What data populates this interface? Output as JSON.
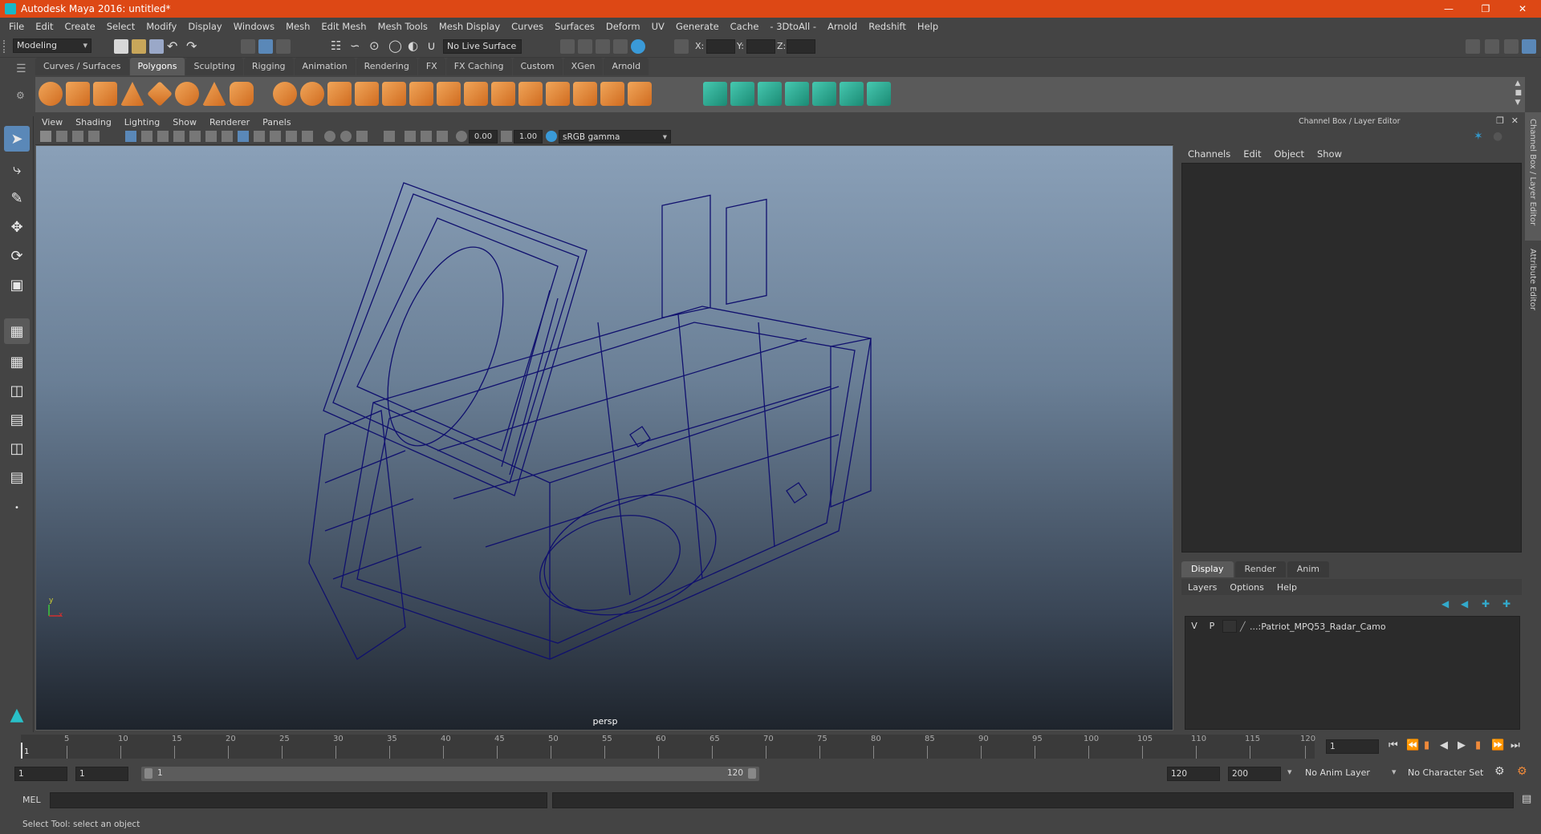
{
  "window": {
    "title": "Autodesk Maya 2016: untitled*"
  },
  "menubar": [
    "File",
    "Edit",
    "Create",
    "Select",
    "Modify",
    "Display",
    "Windows",
    "Mesh",
    "Edit Mesh",
    "Mesh Tools",
    "Mesh Display",
    "Curves",
    "Surfaces",
    "Deform",
    "UV",
    "Generate",
    "Cache",
    "- 3DtoAll -",
    "Arnold",
    "Redshift",
    "Help"
  ],
  "statusline": {
    "mode": "Modeling",
    "live_surface": "No Live Surface",
    "x_label": "X:",
    "y_label": "Y:",
    "z_label": "Z:"
  },
  "shelf": {
    "tabs": [
      "Curves / Surfaces",
      "Polygons",
      "Sculpting",
      "Rigging",
      "Animation",
      "Rendering",
      "FX",
      "FX Caching",
      "Custom",
      "XGen",
      "Arnold"
    ],
    "active_tab": "Polygons"
  },
  "viewport": {
    "menus": [
      "View",
      "Shading",
      "Lighting",
      "Show",
      "Renderer",
      "Panels"
    ],
    "exposure": "0.00",
    "gamma": "1.00",
    "color_space": "sRGB gamma",
    "camera": "persp",
    "axis_y": "y",
    "axis_x": "x"
  },
  "channel_box": {
    "title": "Channel Box / Layer Editor",
    "menus": [
      "Channels",
      "Edit",
      "Object",
      "Show"
    ],
    "side_tab_1": "Channel Box / Layer Editor",
    "side_tab_2": "Attribute Editor"
  },
  "layer_editor": {
    "tabs": [
      "Display",
      "Render",
      "Anim"
    ],
    "active_tab": "Display",
    "menus": [
      "Layers",
      "Options",
      "Help"
    ],
    "layers": [
      {
        "v": "V",
        "p": "P",
        "name": "...:Patriot_MPQ53_Radar_Camo"
      }
    ]
  },
  "timeline": {
    "ticks": [
      "5",
      "10",
      "15",
      "20",
      "25",
      "30",
      "35",
      "40",
      "45",
      "50",
      "55",
      "60",
      "65",
      "70",
      "75",
      "80",
      "85",
      "90",
      "95",
      "100",
      "105",
      "110",
      "115",
      "120"
    ],
    "start_label": "1",
    "current_frame": "1"
  },
  "range": {
    "start": "1",
    "playback_start": "1",
    "slider_start": "1",
    "slider_end": "120",
    "playback_end": "120",
    "end": "200",
    "anim_layer": "No Anim Layer",
    "character_set": "No Character Set"
  },
  "cmdline": {
    "label": "MEL"
  },
  "helpline": {
    "text": "Select Tool: select an object"
  }
}
